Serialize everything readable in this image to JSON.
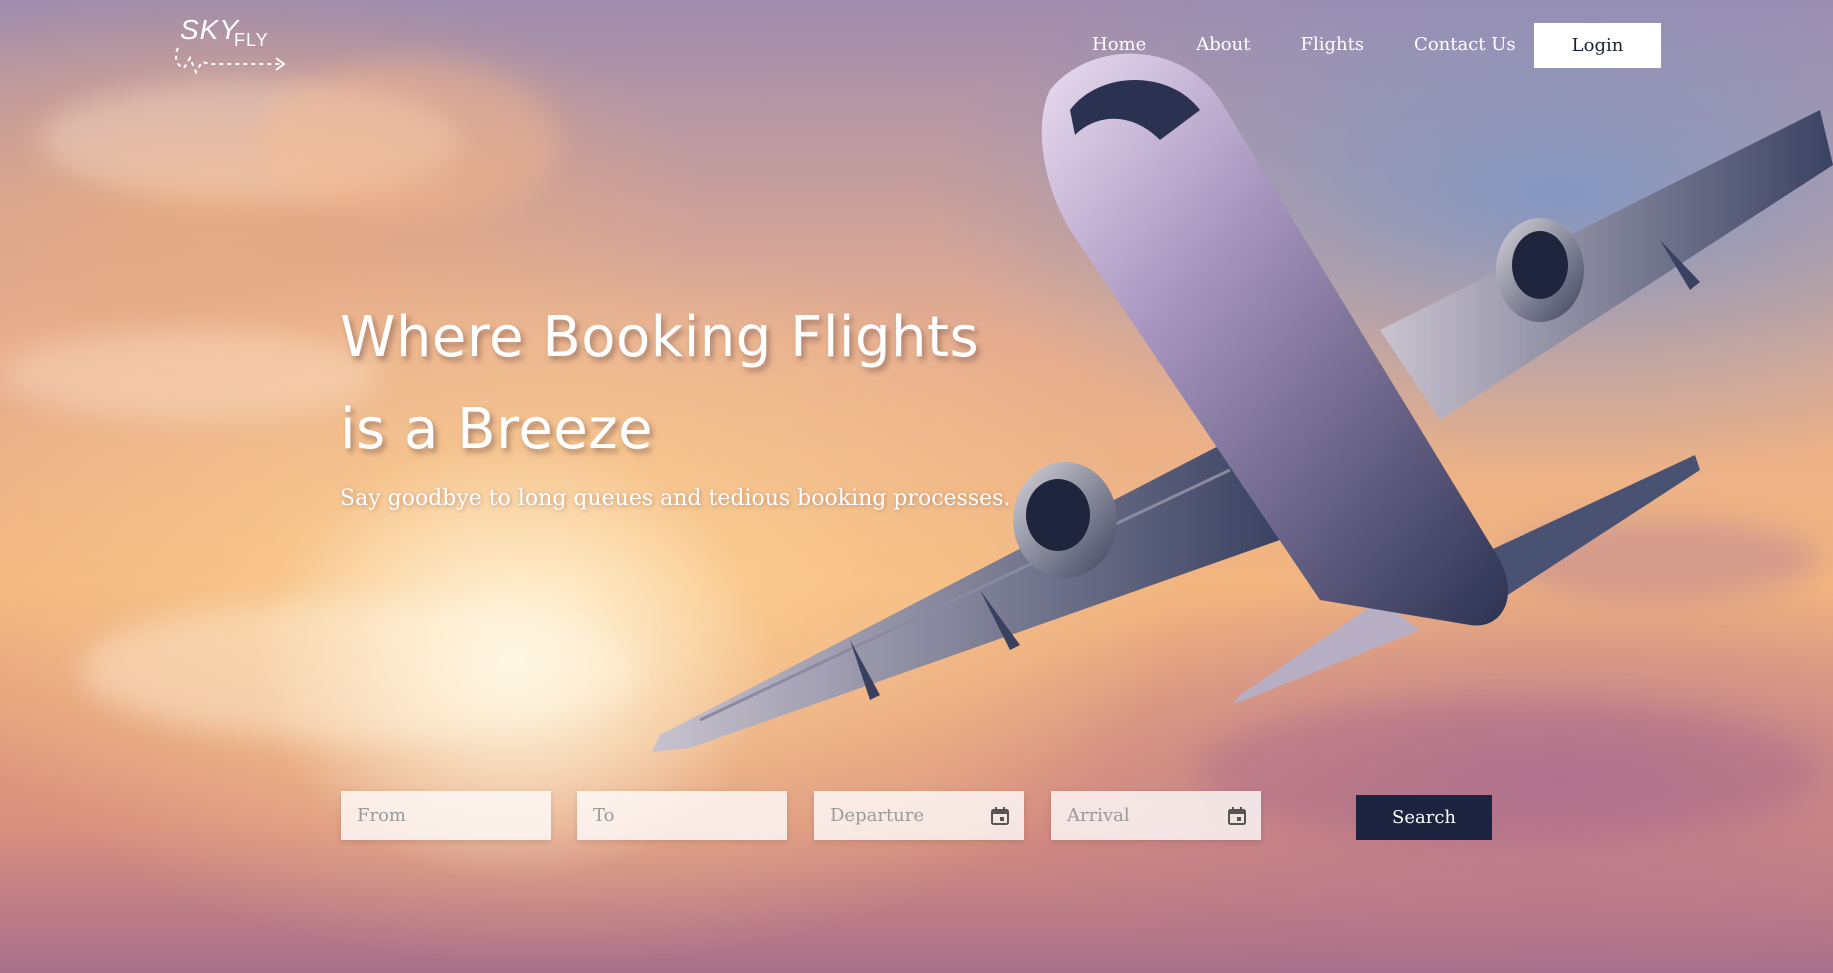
{
  "logo": {
    "sky": "SKY",
    "fly": "FLY"
  },
  "nav": {
    "items": [
      "Home",
      "About",
      "Flights",
      "Contact Us"
    ],
    "login_label": "Login"
  },
  "hero": {
    "headline_line1": "Where Booking Flights",
    "headline_line2": "is a Breeze",
    "subtitle": "Say goodbye to long queues and tedious booking processes."
  },
  "search": {
    "from_placeholder": "From",
    "to_placeholder": "To",
    "departure_placeholder": "Departure",
    "arrival_placeholder": "Arrival",
    "button_label": "Search"
  },
  "icons": {
    "calendar": "calendar-icon",
    "airplane": "airplane-image"
  },
  "colors": {
    "button_dark": "#1d2440",
    "login_bg": "#ffffff"
  }
}
